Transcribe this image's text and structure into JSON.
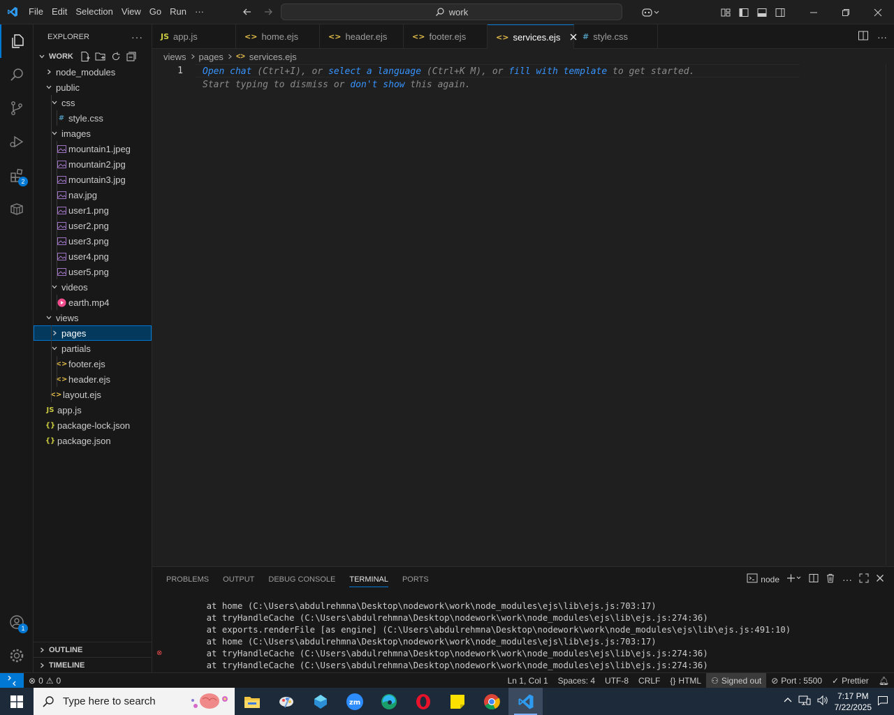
{
  "titlebar": {
    "menu": [
      "File",
      "Edit",
      "Selection",
      "View",
      "Go",
      "Run",
      "···"
    ],
    "search": "work"
  },
  "activity": {
    "extensions_badge": "2",
    "accounts_badge": "1"
  },
  "explorer": {
    "title": "EXPLORER",
    "section": "WORK",
    "tree": [
      {
        "label": "node_modules",
        "type": "folder-closed",
        "depth": 0
      },
      {
        "label": "public",
        "type": "folder-open",
        "depth": 0
      },
      {
        "label": "css",
        "type": "folder-open",
        "depth": 1
      },
      {
        "label": "style.css",
        "type": "css",
        "depth": 2
      },
      {
        "label": "images",
        "type": "folder-open",
        "depth": 1
      },
      {
        "label": "mountain1.jpeg",
        "type": "image",
        "depth": 2
      },
      {
        "label": "mountain2.jpg",
        "type": "image",
        "depth": 2
      },
      {
        "label": "mountain3.jpg",
        "type": "image",
        "depth": 2
      },
      {
        "label": "nav.jpg",
        "type": "image",
        "depth": 2
      },
      {
        "label": "user1.png",
        "type": "image",
        "depth": 2
      },
      {
        "label": "user2.png",
        "type": "image",
        "depth": 2
      },
      {
        "label": "user3.png",
        "type": "image",
        "depth": 2
      },
      {
        "label": "user4.png",
        "type": "image",
        "depth": 2
      },
      {
        "label": "user5.png",
        "type": "image",
        "depth": 2
      },
      {
        "label": "videos",
        "type": "folder-open",
        "depth": 1
      },
      {
        "label": "earth.mp4",
        "type": "video",
        "depth": 2
      },
      {
        "label": "views",
        "type": "folder-open",
        "depth": 0
      },
      {
        "label": "pages",
        "type": "folder-closed",
        "depth": 1,
        "selected": true
      },
      {
        "label": "partials",
        "type": "folder-open",
        "depth": 1
      },
      {
        "label": "footer.ejs",
        "type": "ejs",
        "depth": 2
      },
      {
        "label": "header.ejs",
        "type": "ejs",
        "depth": 2
      },
      {
        "label": "layout.ejs",
        "type": "ejs",
        "depth": 1
      },
      {
        "label": "app.js",
        "type": "js",
        "depth": 0
      },
      {
        "label": "package-lock.json",
        "type": "json",
        "depth": 0
      },
      {
        "label": "package.json",
        "type": "json",
        "depth": 0
      }
    ],
    "outline": "OUTLINE",
    "timeline": "TIMELINE"
  },
  "tabs": [
    {
      "label": "app.js",
      "type": "js"
    },
    {
      "label": "home.ejs",
      "type": "ejs"
    },
    {
      "label": "header.ejs",
      "type": "ejs"
    },
    {
      "label": "footer.ejs",
      "type": "ejs"
    },
    {
      "label": "services.ejs",
      "type": "ejs",
      "active": true
    },
    {
      "label": "style.css",
      "type": "css"
    }
  ],
  "breadcrumb": [
    "views",
    "pages",
    "services.ejs"
  ],
  "editor": {
    "line_number": "1",
    "hint_open_chat": "Open chat",
    "hint_1a": " (Ctrl+I), or ",
    "hint_select_lang": "select a language",
    "hint_1b": " (Ctrl+K M), or ",
    "hint_fill": "fill with template",
    "hint_1c": " to get started.",
    "hint_2a": "Start typing to dismiss or ",
    "hint_dont_show": "don't show",
    "hint_2b": " this again."
  },
  "panel": {
    "tabs": [
      "PROBLEMS",
      "OUTPUT",
      "DEBUG CONSOLE",
      "TERMINAL",
      "PORTS"
    ],
    "active_tab": "TERMINAL",
    "terminal_name": "node",
    "lines": [
      "    at home (C:\\Users\\abdulrehmna\\Desktop\\nodework\\work\\node_modules\\ejs\\lib\\ejs.js:703:17)",
      "    at tryHandleCache (C:\\Users\\abdulrehmna\\Desktop\\nodework\\work\\node_modules\\ejs\\lib\\ejs.js:274:36)",
      "    at exports.renderFile [as engine] (C:\\Users\\abdulrehmna\\Desktop\\nodework\\work\\node_modules\\ejs\\lib\\ejs.js:491:10)",
      "    at home (C:\\Users\\abdulrehmna\\Desktop\\nodework\\work\\node_modules\\ejs\\lib\\ejs.js:703:17)",
      "    at tryHandleCache (C:\\Users\\abdulrehmna\\Desktop\\nodework\\work\\node_modules\\ejs\\lib\\ejs.js:274:36)",
      "    at tryHandleCache (C:\\Users\\abdulrehmna\\Desktop\\nodework\\work\\node_modules\\ejs\\lib\\ejs.js:274:36)"
    ]
  },
  "status": {
    "errors": "0",
    "warnings": "0",
    "position": "Ln 1, Col 1",
    "spaces": "Spaces: 4",
    "encoding": "UTF-8",
    "eol": "CRLF",
    "language": "HTML",
    "account": "Signed out",
    "port": "Port : 5500",
    "prettier": "Prettier"
  },
  "taskbar": {
    "search_placeholder": "Type here to search",
    "time": "7:17 PM",
    "date": "7/22/2025"
  },
  "colors": {
    "accent": "#0078d4",
    "link": "#3794ff",
    "ejs": "#e8c04a",
    "js": "#cbcb41",
    "css": "#519aba",
    "image": "#a074c4",
    "video": "#f14c8c",
    "json": "#cbcb41"
  }
}
